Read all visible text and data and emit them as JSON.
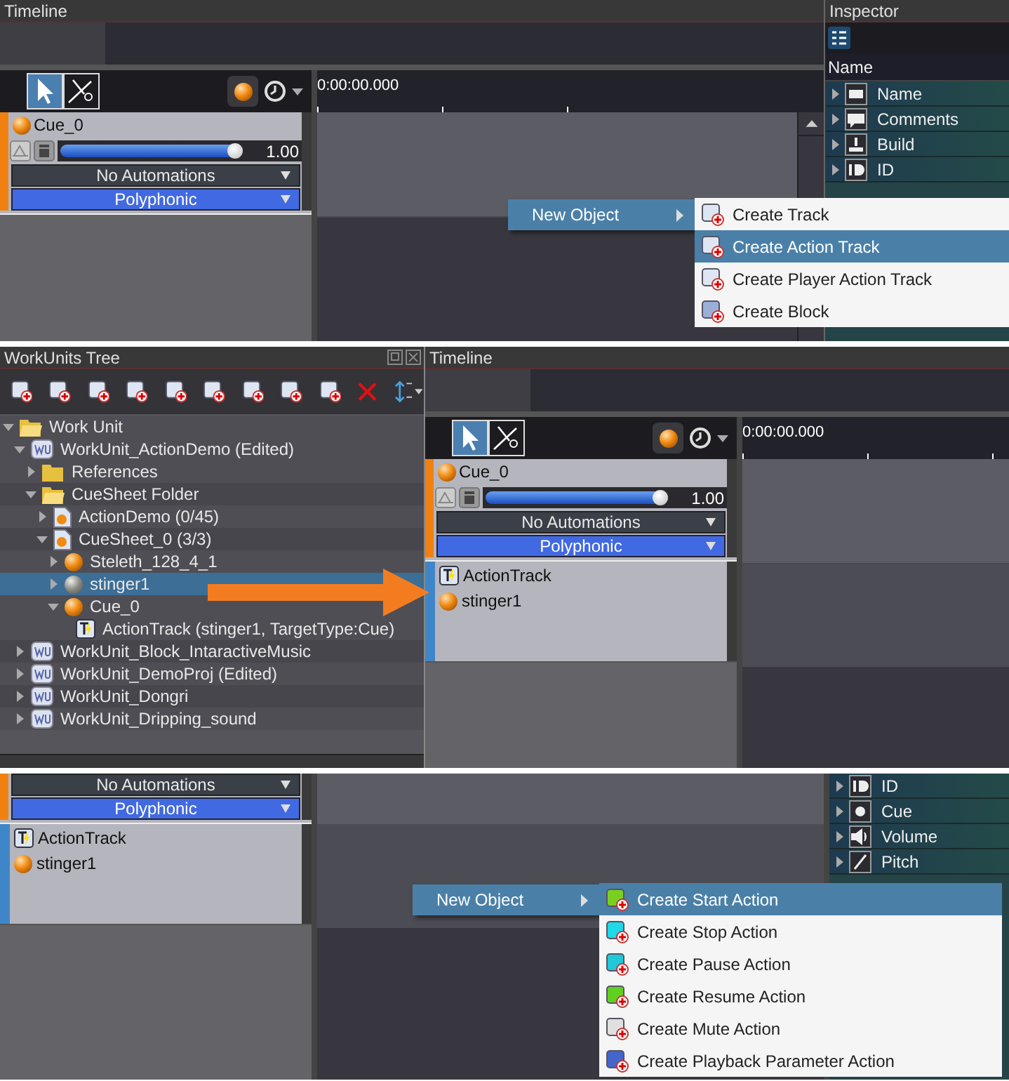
{
  "views": [
    {
      "kind": "timeline_inspector",
      "timeline": {
        "title": "Timeline",
        "time": "0:00:00.000",
        "tracks": [
          {
            "kind": "cue",
            "name": "Cue_0",
            "level": 1,
            "reading": "1.00",
            "automation": "No Automations",
            "mode": "Polyphonic"
          }
        ]
      },
      "menu": {
        "label": "New Object",
        "items": [
          {
            "kind": "track",
            "label": "Create Track",
            "selected": false
          },
          {
            "kind": "action_track",
            "label": "Create Action Track",
            "selected": true
          },
          {
            "kind": "player_track",
            "label": "Create Player Action Track",
            "selected": false
          },
          {
            "kind": "block",
            "label": "Create Block",
            "selected": false
          }
        ]
      },
      "inspector": {
        "title": "Inspector",
        "column": "Name",
        "rows": [
          {
            "kind": "name",
            "label": "Name"
          },
          {
            "kind": "comments",
            "label": "Comments"
          },
          {
            "kind": "build",
            "label": "Build"
          },
          {
            "kind": "id",
            "label": "ID"
          }
        ]
      }
    },
    {
      "kind": "tree_timeline",
      "tree": {
        "title": "WorkUnits Tree",
        "nodes": [
          {
            "kind": "folder",
            "label": "Work Unit",
            "expanded": true,
            "selected": false,
            "children": [
              {
                "kind": "workunit",
                "label": "WorkUnit_ActionDemo (Edited)",
                "expanded": true,
                "selected": false,
                "children": [
                  {
                    "kind": "folder",
                    "label": "References",
                    "expanded": false,
                    "selected": false
                  },
                  {
                    "kind": "folder",
                    "label": "CueSheet Folder",
                    "expanded": true,
                    "selected": false,
                    "children": [
                      {
                        "kind": "cuesheet",
                        "label": "ActionDemo (0/45)",
                        "expanded": false,
                        "selected": false
                      },
                      {
                        "kind": "cuesheet",
                        "label": "CueSheet_0 (3/3)",
                        "expanded": true,
                        "selected": false,
                        "children": [
                          {
                            "kind": "cue",
                            "label": "Steleth_128_4_1",
                            "expanded": false,
                            "selected": false
                          },
                          {
                            "kind": "cue",
                            "label": "stinger1",
                            "expanded": false,
                            "selected": true
                          },
                          {
                            "kind": "cue",
                            "label": "Cue_0",
                            "expanded": true,
                            "selected": false,
                            "children": [
                              {
                                "kind": "action_track",
                                "label": "ActionTrack (stinger1, TargetType:Cue)",
                                "selected": false
                              }
                            ]
                          }
                        ]
                      }
                    ]
                  }
                ]
              },
              {
                "kind": "workunit",
                "label": "WorkUnit_Block_IntaractiveMusic",
                "expanded": false,
                "selected": false
              },
              {
                "kind": "workunit",
                "label": "WorkUnit_DemoProj (Edited)",
                "expanded": false,
                "selected": false
              },
              {
                "kind": "workunit",
                "label": "WorkUnit_Dongri",
                "expanded": false,
                "selected": false
              },
              {
                "kind": "workunit",
                "label": "WorkUnit_Dripping_sound",
                "expanded": false,
                "selected": false
              }
            ]
          }
        ]
      },
      "timeline": {
        "title": "Timeline",
        "time": "0:00:00.000",
        "tracks": [
          {
            "kind": "cue",
            "name": "Cue_0",
            "level": 1,
            "reading": "1.00",
            "automation": "No Automations",
            "mode": "Polyphonic"
          },
          {
            "kind": "action",
            "items": [
              {
                "kind": "action_track",
                "label": "ActionTrack"
              },
              {
                "kind": "cue",
                "label": "stinger1"
              }
            ]
          }
        ]
      }
    },
    {
      "kind": "tracks_menu",
      "tracks": [
        {
          "kind": "cue",
          "automation": "No Automations",
          "mode": "Polyphonic"
        },
        {
          "kind": "action",
          "items": [
            {
              "kind": "action_track",
              "label": "ActionTrack"
            },
            {
              "kind": "cue",
              "label": "stinger1"
            }
          ]
        }
      ],
      "inspector": {
        "rows": [
          {
            "kind": "id",
            "label": "ID"
          },
          {
            "kind": "cue",
            "label": "Cue"
          },
          {
            "kind": "volume",
            "label": "Volume"
          },
          {
            "kind": "pitch",
            "label": "Pitch"
          }
        ]
      },
      "menu": {
        "label": "New Object",
        "items": [
          {
            "kind": "start",
            "label": "Create Start Action",
            "selected": true
          },
          {
            "kind": "stop",
            "label": "Create Stop Action",
            "selected": false
          },
          {
            "kind": "pause",
            "label": "Create Pause Action",
            "selected": false
          },
          {
            "kind": "resume",
            "label": "Create Resume Action",
            "selected": false
          },
          {
            "kind": "mute",
            "label": "Create Mute Action",
            "selected": false
          },
          {
            "kind": "param",
            "label": "Create Playback Parameter Action",
            "selected": false
          }
        ]
      }
    }
  ]
}
